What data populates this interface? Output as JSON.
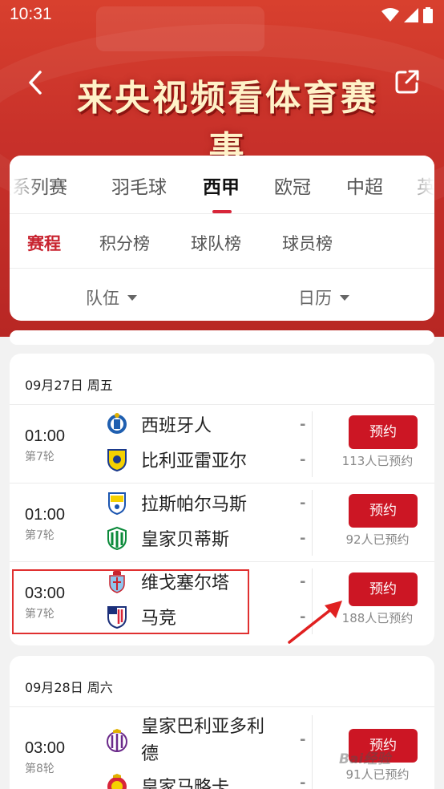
{
  "status_bar": {
    "time": "10:31"
  },
  "banner": {
    "title": "来央视频看体育赛事"
  },
  "sport_tabs": [
    {
      "label": "联系列赛"
    },
    {
      "label": "羽毛球"
    },
    {
      "label": "西甲",
      "active": true
    },
    {
      "label": "欧冠"
    },
    {
      "label": "中超"
    },
    {
      "label": "英"
    }
  ],
  "sub_tabs": [
    {
      "label": "赛程",
      "active": true
    },
    {
      "label": "积分榜"
    },
    {
      "label": "球队榜"
    },
    {
      "label": "球员榜"
    }
  ],
  "filters": {
    "team": "队伍",
    "calendar": "日历"
  },
  "days": [
    {
      "date": "09月27日 周五",
      "matches": [
        {
          "time": "01:00",
          "round": "第7轮",
          "home": "西班牙人",
          "away": "比利亚雷亚尔",
          "home_score": "-",
          "away_score": "-",
          "button": "预约",
          "count": "113人已预约"
        },
        {
          "time": "01:00",
          "round": "第7轮",
          "home": "拉斯帕尔马斯",
          "away": "皇家贝蒂斯",
          "home_score": "-",
          "away_score": "-",
          "button": "预约",
          "count": "92人已预约"
        },
        {
          "time": "03:00",
          "round": "第7轮",
          "home": "维戈塞尔塔",
          "away": "马竞",
          "home_score": "-",
          "away_score": "-",
          "button": "预约",
          "count": "188人已预约"
        }
      ]
    },
    {
      "date": "09月28日 周六",
      "matches": [
        {
          "time": "03:00",
          "round": "第8轮",
          "home_line1": "皇家巴利亚多利",
          "home_line2": "德",
          "away": "皇家马略卡",
          "home_score": "-",
          "away_score": "-",
          "button": "预约",
          "count": "91人已预约"
        }
      ]
    }
  ],
  "watermark": "Bai经验",
  "colors": {
    "accent": "#cc1624",
    "header_red": "#c8312a"
  }
}
